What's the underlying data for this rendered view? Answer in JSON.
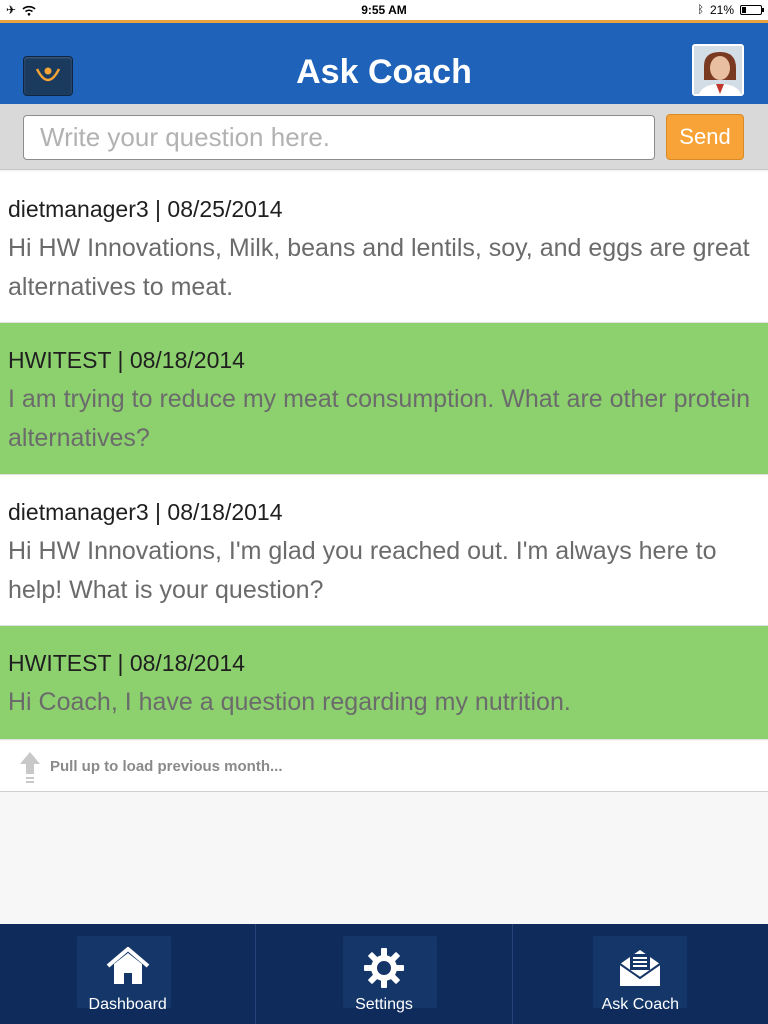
{
  "status_bar": {
    "time": "9:55 AM",
    "battery": "21%"
  },
  "header": {
    "title": "Ask Coach",
    "logo_icon": "app-logo-icon",
    "avatar_icon": "coach-avatar-icon"
  },
  "question": {
    "placeholder": "Write your question here.",
    "send_label": "Send"
  },
  "messages": [
    {
      "author": "dietmanager3 | 08/25/2014",
      "text": "Hi HW Innovations, Milk, beans and lentils, soy, and eggs are great alternatives to meat."
    },
    {
      "author": "HWITEST | 08/18/2014",
      "text": "I am trying to reduce my meat consumption. What are other protein alternatives?"
    },
    {
      "author": "dietmanager3 | 08/18/2014",
      "text": "Hi HW Innovations, I'm glad you reached out. I'm always here to help! What is your question?"
    },
    {
      "author": "HWITEST | 08/18/2014",
      "text": "Hi Coach, I have a question regarding my nutrition."
    }
  ],
  "pull_hint": "Pull up to load previous month...",
  "tabs": [
    {
      "label": "Dashboard",
      "icon": "home-icon"
    },
    {
      "label": "Settings",
      "icon": "gear-icon"
    },
    {
      "label": "Ask Coach",
      "icon": "envelope-icon"
    }
  ],
  "colors": {
    "header": "#1e63b9",
    "send": "#f7a337",
    "user_bubble": "#8dd16f",
    "tab_bar": "#0e2b5c"
  }
}
